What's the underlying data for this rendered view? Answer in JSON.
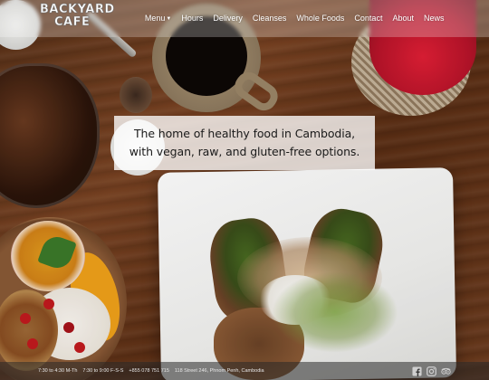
{
  "header": {
    "logo_line1": "BACKYARD",
    "logo_line2": "CAFE",
    "nav": [
      {
        "label": "Menu",
        "has_dropdown": true
      },
      {
        "label": "Hours"
      },
      {
        "label": "Delivery"
      },
      {
        "label": "Cleanses"
      },
      {
        "label": "Whole Foods"
      },
      {
        "label": "Contact"
      },
      {
        "label": "About"
      },
      {
        "label": "News"
      }
    ]
  },
  "hero": {
    "tagline_line1": "The home of healthy food in Cambodia,",
    "tagline_line2": "with vegan, raw, and gluten-free options."
  },
  "footer": {
    "hours_weekday": "7:30 to 4:30 M-Th",
    "hours_weekend": "7:30 to 9:00 F-S-S",
    "phone": "+855 078 751 715",
    "address": "118 Street 246, Phnom Penh, Cambodia",
    "social": [
      "facebook-icon",
      "instagram-icon",
      "tripadvisor-icon"
    ]
  },
  "colors": {
    "header_bg": "rgba(255,255,255,0.25)",
    "tagline_bg": "rgba(255,255,255,0.78)",
    "footer_bg": "rgba(40,40,40,0.55)",
    "text_light": "#ffffff",
    "text_dark": "#1a1a1a"
  }
}
